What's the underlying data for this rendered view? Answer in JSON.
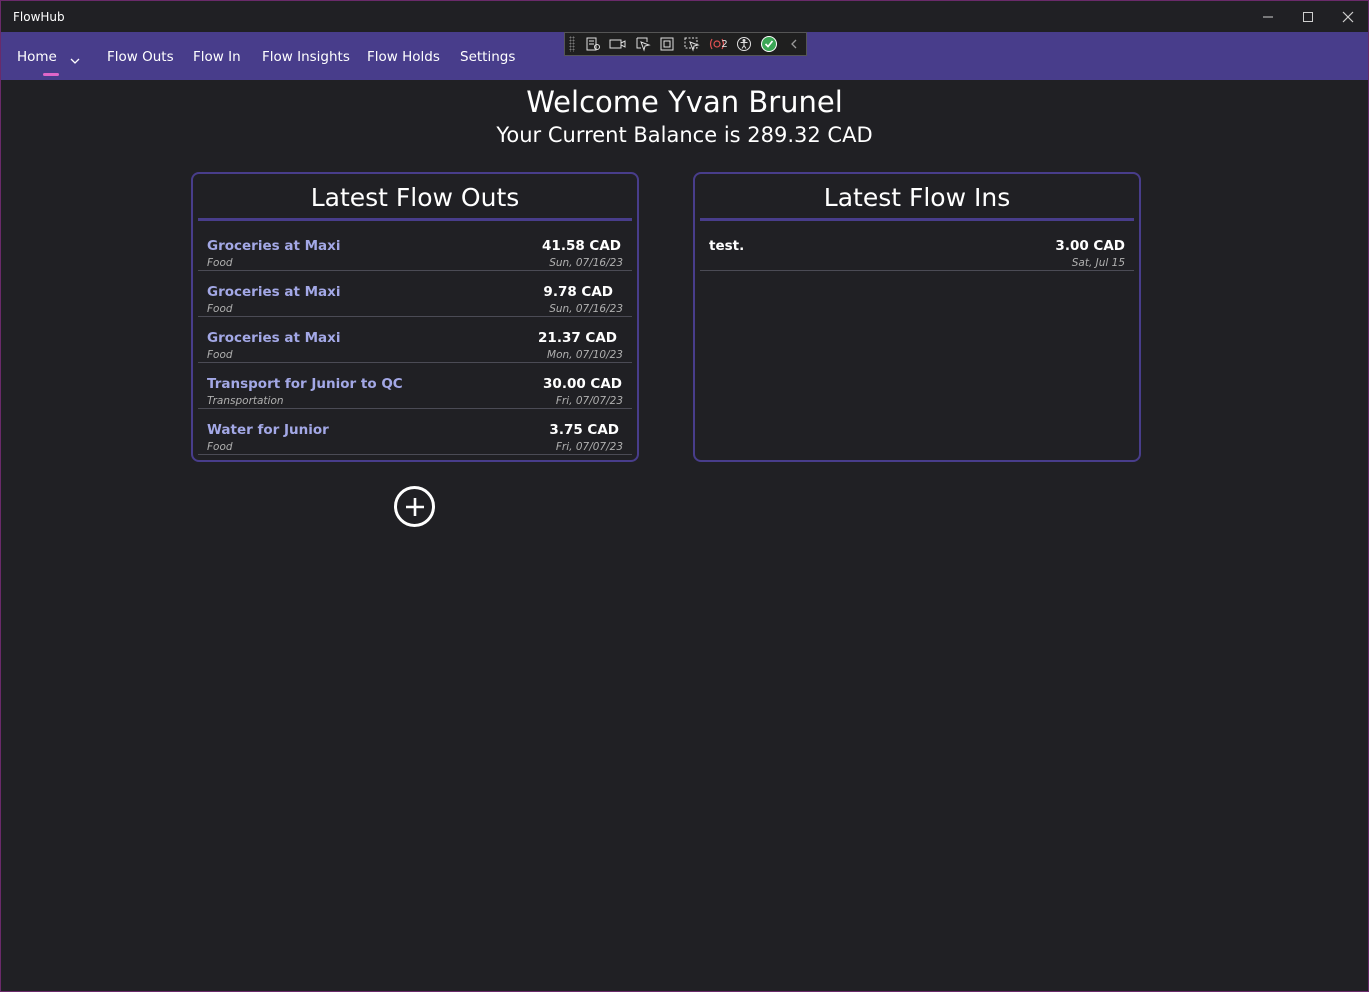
{
  "window": {
    "title": "FlowHub"
  },
  "nav": {
    "items": [
      {
        "label": "Home"
      },
      {
        "label": "Flow Outs"
      },
      {
        "label": "Flow In"
      },
      {
        "label": "Flow Insights"
      },
      {
        "label": "Flow Holds"
      },
      {
        "label": "Settings"
      }
    ],
    "active": "Home"
  },
  "devtools": {
    "icons": [
      "live-visual-tree-icon",
      "record-icon",
      "select-element-icon",
      "display-layout-adorners-icon",
      "track-focus-icon",
      "binding-failures-icon",
      "accessibility-icon",
      "hot-reload-status-icon",
      "collapse-chevron-icon"
    ],
    "binding_failures_count": "2"
  },
  "header": {
    "welcome": "Welcome Yvan Brunel",
    "balance": "Your Current Balance is 289.32 CAD"
  },
  "flow_outs": {
    "title": "Latest Flow Outs",
    "rows": [
      {
        "title": "Groceries at Maxi",
        "category": "Food",
        "amount": "41.58 CAD",
        "date": "Sun, 07/16/23"
      },
      {
        "title": "Groceries at Maxi",
        "category": "Food",
        "amount": "9.78 CAD",
        "date": "Sun, 07/16/23"
      },
      {
        "title": "Groceries at Maxi",
        "category": "Food",
        "amount": "21.37 CAD",
        "date": "Mon, 07/10/23"
      },
      {
        "title": "Transport for Junior to QC",
        "category": "Transportation",
        "amount": "30.00 CAD",
        "date": "Fri, 07/07/23"
      },
      {
        "title": "Water for Junior",
        "category": "Food",
        "amount": "3.75 CAD",
        "date": "Fri, 07/07/23"
      }
    ]
  },
  "flow_ins": {
    "title": "Latest Flow Ins",
    "rows": [
      {
        "title": "test.",
        "amount": "3.00 CAD",
        "date": "Sat, Jul 15"
      }
    ]
  },
  "colors": {
    "accent": "#483d8b",
    "background": "#202024",
    "link_text": "#a3a8e6",
    "nav_indicator": "#e066c8"
  }
}
